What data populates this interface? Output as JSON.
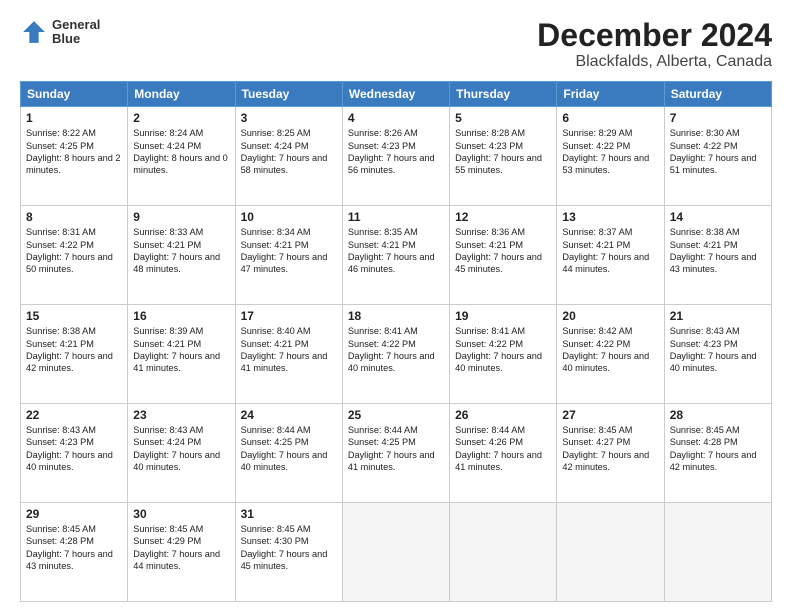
{
  "header": {
    "logo_line1": "General",
    "logo_line2": "Blue",
    "month": "December 2024",
    "location": "Blackfalds, Alberta, Canada"
  },
  "weekdays": [
    "Sunday",
    "Monday",
    "Tuesday",
    "Wednesday",
    "Thursday",
    "Friday",
    "Saturday"
  ],
  "weeks": [
    [
      {
        "day": "1",
        "sunrise": "Sunrise: 8:22 AM",
        "sunset": "Sunset: 4:25 PM",
        "daylight": "Daylight: 8 hours and 2 minutes."
      },
      {
        "day": "2",
        "sunrise": "Sunrise: 8:24 AM",
        "sunset": "Sunset: 4:24 PM",
        "daylight": "Daylight: 8 hours and 0 minutes."
      },
      {
        "day": "3",
        "sunrise": "Sunrise: 8:25 AM",
        "sunset": "Sunset: 4:24 PM",
        "daylight": "Daylight: 7 hours and 58 minutes."
      },
      {
        "day": "4",
        "sunrise": "Sunrise: 8:26 AM",
        "sunset": "Sunset: 4:23 PM",
        "daylight": "Daylight: 7 hours and 56 minutes."
      },
      {
        "day": "5",
        "sunrise": "Sunrise: 8:28 AM",
        "sunset": "Sunset: 4:23 PM",
        "daylight": "Daylight: 7 hours and 55 minutes."
      },
      {
        "day": "6",
        "sunrise": "Sunrise: 8:29 AM",
        "sunset": "Sunset: 4:22 PM",
        "daylight": "Daylight: 7 hours and 53 minutes."
      },
      {
        "day": "7",
        "sunrise": "Sunrise: 8:30 AM",
        "sunset": "Sunset: 4:22 PM",
        "daylight": "Daylight: 7 hours and 51 minutes."
      }
    ],
    [
      {
        "day": "8",
        "sunrise": "Sunrise: 8:31 AM",
        "sunset": "Sunset: 4:22 PM",
        "daylight": "Daylight: 7 hours and 50 minutes."
      },
      {
        "day": "9",
        "sunrise": "Sunrise: 8:33 AM",
        "sunset": "Sunset: 4:21 PM",
        "daylight": "Daylight: 7 hours and 48 minutes."
      },
      {
        "day": "10",
        "sunrise": "Sunrise: 8:34 AM",
        "sunset": "Sunset: 4:21 PM",
        "daylight": "Daylight: 7 hours and 47 minutes."
      },
      {
        "day": "11",
        "sunrise": "Sunrise: 8:35 AM",
        "sunset": "Sunset: 4:21 PM",
        "daylight": "Daylight: 7 hours and 46 minutes."
      },
      {
        "day": "12",
        "sunrise": "Sunrise: 8:36 AM",
        "sunset": "Sunset: 4:21 PM",
        "daylight": "Daylight: 7 hours and 45 minutes."
      },
      {
        "day": "13",
        "sunrise": "Sunrise: 8:37 AM",
        "sunset": "Sunset: 4:21 PM",
        "daylight": "Daylight: 7 hours and 44 minutes."
      },
      {
        "day": "14",
        "sunrise": "Sunrise: 8:38 AM",
        "sunset": "Sunset: 4:21 PM",
        "daylight": "Daylight: 7 hours and 43 minutes."
      }
    ],
    [
      {
        "day": "15",
        "sunrise": "Sunrise: 8:38 AM",
        "sunset": "Sunset: 4:21 PM",
        "daylight": "Daylight: 7 hours and 42 minutes."
      },
      {
        "day": "16",
        "sunrise": "Sunrise: 8:39 AM",
        "sunset": "Sunset: 4:21 PM",
        "daylight": "Daylight: 7 hours and 41 minutes."
      },
      {
        "day": "17",
        "sunrise": "Sunrise: 8:40 AM",
        "sunset": "Sunset: 4:21 PM",
        "daylight": "Daylight: 7 hours and 41 minutes."
      },
      {
        "day": "18",
        "sunrise": "Sunrise: 8:41 AM",
        "sunset": "Sunset: 4:22 PM",
        "daylight": "Daylight: 7 hours and 40 minutes."
      },
      {
        "day": "19",
        "sunrise": "Sunrise: 8:41 AM",
        "sunset": "Sunset: 4:22 PM",
        "daylight": "Daylight: 7 hours and 40 minutes."
      },
      {
        "day": "20",
        "sunrise": "Sunrise: 8:42 AM",
        "sunset": "Sunset: 4:22 PM",
        "daylight": "Daylight: 7 hours and 40 minutes."
      },
      {
        "day": "21",
        "sunrise": "Sunrise: 8:43 AM",
        "sunset": "Sunset: 4:23 PM",
        "daylight": "Daylight: 7 hours and 40 minutes."
      }
    ],
    [
      {
        "day": "22",
        "sunrise": "Sunrise: 8:43 AM",
        "sunset": "Sunset: 4:23 PM",
        "daylight": "Daylight: 7 hours and 40 minutes."
      },
      {
        "day": "23",
        "sunrise": "Sunrise: 8:43 AM",
        "sunset": "Sunset: 4:24 PM",
        "daylight": "Daylight: 7 hours and 40 minutes."
      },
      {
        "day": "24",
        "sunrise": "Sunrise: 8:44 AM",
        "sunset": "Sunset: 4:25 PM",
        "daylight": "Daylight: 7 hours and 40 minutes."
      },
      {
        "day": "25",
        "sunrise": "Sunrise: 8:44 AM",
        "sunset": "Sunset: 4:25 PM",
        "daylight": "Daylight: 7 hours and 41 minutes."
      },
      {
        "day": "26",
        "sunrise": "Sunrise: 8:44 AM",
        "sunset": "Sunset: 4:26 PM",
        "daylight": "Daylight: 7 hours and 41 minutes."
      },
      {
        "day": "27",
        "sunrise": "Sunrise: 8:45 AM",
        "sunset": "Sunset: 4:27 PM",
        "daylight": "Daylight: 7 hours and 42 minutes."
      },
      {
        "day": "28",
        "sunrise": "Sunrise: 8:45 AM",
        "sunset": "Sunset: 4:28 PM",
        "daylight": "Daylight: 7 hours and 42 minutes."
      }
    ],
    [
      {
        "day": "29",
        "sunrise": "Sunrise: 8:45 AM",
        "sunset": "Sunset: 4:28 PM",
        "daylight": "Daylight: 7 hours and 43 minutes."
      },
      {
        "day": "30",
        "sunrise": "Sunrise: 8:45 AM",
        "sunset": "Sunset: 4:29 PM",
        "daylight": "Daylight: 7 hours and 44 minutes."
      },
      {
        "day": "31",
        "sunrise": "Sunrise: 8:45 AM",
        "sunset": "Sunset: 4:30 PM",
        "daylight": "Daylight: 7 hours and 45 minutes."
      },
      null,
      null,
      null,
      null
    ]
  ]
}
